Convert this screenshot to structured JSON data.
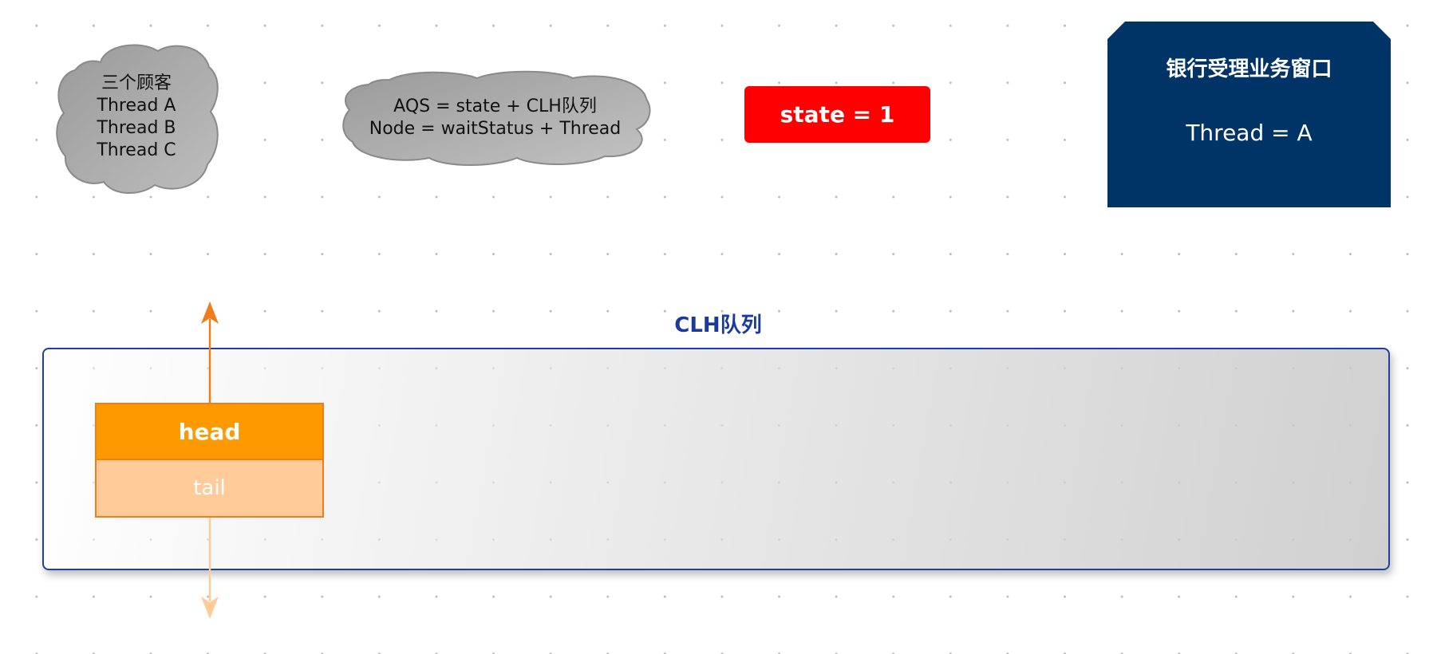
{
  "customers_cloud": {
    "lines": [
      "三个顾客",
      "Thread A",
      "Thread B",
      "Thread C"
    ]
  },
  "aqs_cloud": {
    "lines": [
      "AQS = state + CLH队列",
      "Node = waitStatus + Thread"
    ]
  },
  "state_box": {
    "label": "state = 1"
  },
  "bank_window": {
    "title": "银行受理业务窗口",
    "thread": "Thread = A"
  },
  "clh_queue": {
    "title": "CLH队列",
    "head_label": "head",
    "tail_label": "tail"
  },
  "colors": {
    "cloud": "#a9a9a9",
    "state": "#ff0000",
    "bank_window": "#003366",
    "clh_border": "#1f3fa3",
    "head": "#ff9900",
    "tail": "#ffcc99",
    "arrow_head": "#f07c1a",
    "arrow_tail": "#ffcc99"
  }
}
